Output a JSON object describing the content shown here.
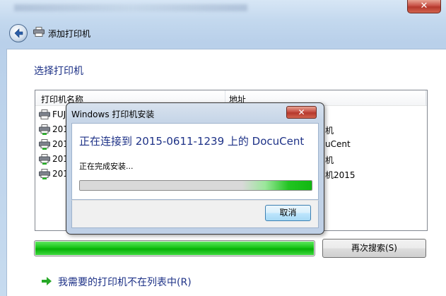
{
  "window": {
    "close_glyph": "✕"
  },
  "nav": {
    "title": "添加打印机",
    "back_icon": "back-arrow-icon",
    "printer_icon": "printer-icon"
  },
  "main": {
    "heading": "选择打印机",
    "list": {
      "col_name": "打印机名称",
      "col_addr": "地址",
      "rows": [
        {
          "name": "FUJI",
          "addr": ""
        },
        {
          "name": "201",
          "addr": "机"
        },
        {
          "name": "201",
          "addr": "uCent"
        },
        {
          "name": "201",
          "addr": "机"
        },
        {
          "name": "201",
          "addr": "机2015"
        }
      ]
    },
    "search_progress": 1.0,
    "search_again_label": "再次搜索(S)",
    "not_listed_link": "我需要的打印机不在列表中(R)"
  },
  "dialog": {
    "title": "Windows 打印机安装",
    "close_glyph": "✕",
    "main_text": "正在连接到 2015-0611-1239 上的 DocuCent",
    "sub_text": "正在完成安装...",
    "progress": 1.0,
    "cancel_label": "取消"
  },
  "colors": {
    "accent_text": "#1e3287",
    "progress_green": "#18c418",
    "close_red": "#c75146"
  }
}
